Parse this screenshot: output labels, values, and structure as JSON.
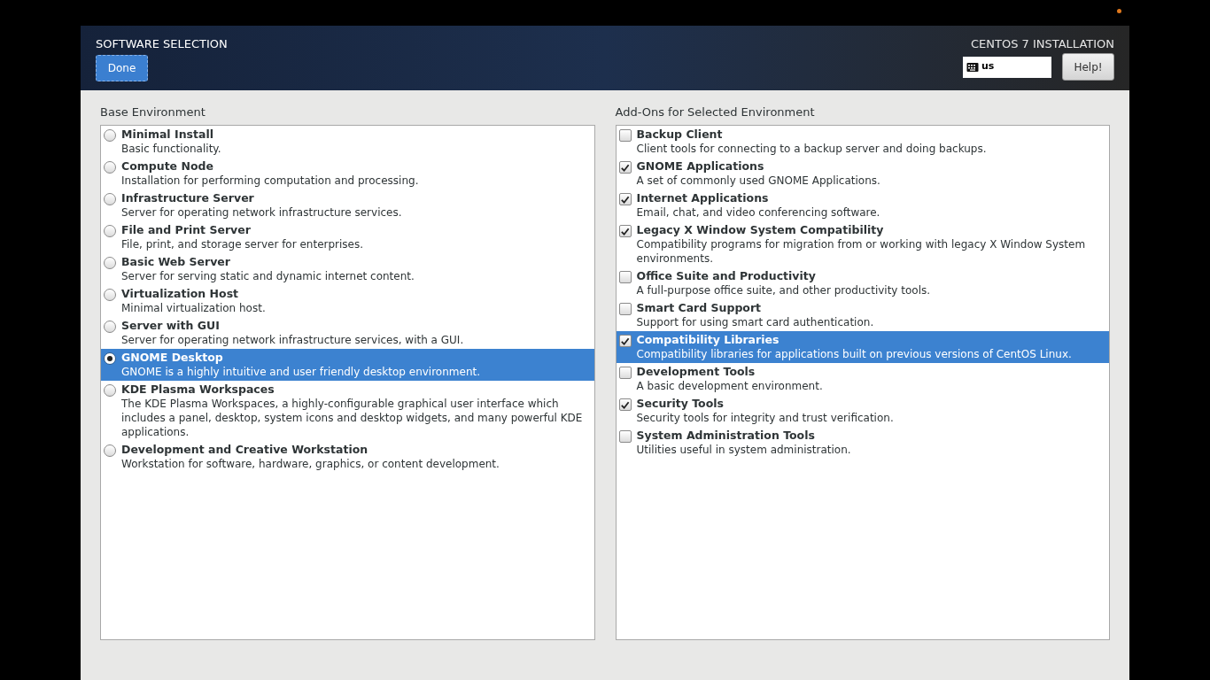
{
  "header": {
    "title": "SOFTWARE SELECTION",
    "done_button": "Done",
    "product": "CENTOS 7 INSTALLATION",
    "keyboard_layout": "us",
    "help_button": "Help!"
  },
  "base_environment": {
    "label": "Base Environment",
    "items": [
      {
        "name": "Minimal Install",
        "description": "Basic functionality.",
        "selected": false
      },
      {
        "name": "Compute Node",
        "description": "Installation for performing computation and processing.",
        "selected": false
      },
      {
        "name": "Infrastructure Server",
        "description": "Server for operating network infrastructure services.",
        "selected": false
      },
      {
        "name": "File and Print Server",
        "description": "File, print, and storage server for enterprises.",
        "selected": false
      },
      {
        "name": "Basic Web Server",
        "description": "Server for serving static and dynamic internet content.",
        "selected": false
      },
      {
        "name": "Virtualization Host",
        "description": "Minimal virtualization host.",
        "selected": false
      },
      {
        "name": "Server with GUI",
        "description": "Server for operating network infrastructure services, with a GUI.",
        "selected": false
      },
      {
        "name": "GNOME Desktop",
        "description": "GNOME is a highly intuitive and user friendly desktop environment.",
        "selected": true
      },
      {
        "name": "KDE Plasma Workspaces",
        "description": "The KDE Plasma Workspaces, a highly-configurable graphical user interface which includes a panel, desktop, system icons and desktop widgets, and many powerful KDE applications.",
        "selected": false
      },
      {
        "name": "Development and Creative Workstation",
        "description": "Workstation for software, hardware, graphics, or content development.",
        "selected": false
      }
    ]
  },
  "addons": {
    "label": "Add-Ons for Selected Environment",
    "items": [
      {
        "name": "Backup Client",
        "description": "Client tools for connecting to a backup server and doing backups.",
        "checked": false,
        "selected": false
      },
      {
        "name": "GNOME Applications",
        "description": "A set of commonly used GNOME Applications.",
        "checked": true,
        "selected": false
      },
      {
        "name": "Internet Applications",
        "description": "Email, chat, and video conferencing software.",
        "checked": true,
        "selected": false
      },
      {
        "name": "Legacy X Window System Compatibility",
        "description": "Compatibility programs for migration from or working with legacy X Window System environments.",
        "checked": true,
        "selected": false
      },
      {
        "name": "Office Suite and Productivity",
        "description": "A full-purpose office suite, and other productivity tools.",
        "checked": false,
        "selected": false
      },
      {
        "name": "Smart Card Support",
        "description": "Support for using smart card authentication.",
        "checked": false,
        "selected": false
      },
      {
        "name": "Compatibility Libraries",
        "description": "Compatibility libraries for applications built on previous versions of CentOS Linux.",
        "checked": true,
        "selected": true
      },
      {
        "name": "Development Tools",
        "description": "A basic development environment.",
        "checked": false,
        "selected": false
      },
      {
        "name": "Security Tools",
        "description": "Security tools for integrity and trust verification.",
        "checked": true,
        "selected": false
      },
      {
        "name": "System Administration Tools",
        "description": "Utilities useful in system administration.",
        "checked": false,
        "selected": false
      }
    ]
  }
}
